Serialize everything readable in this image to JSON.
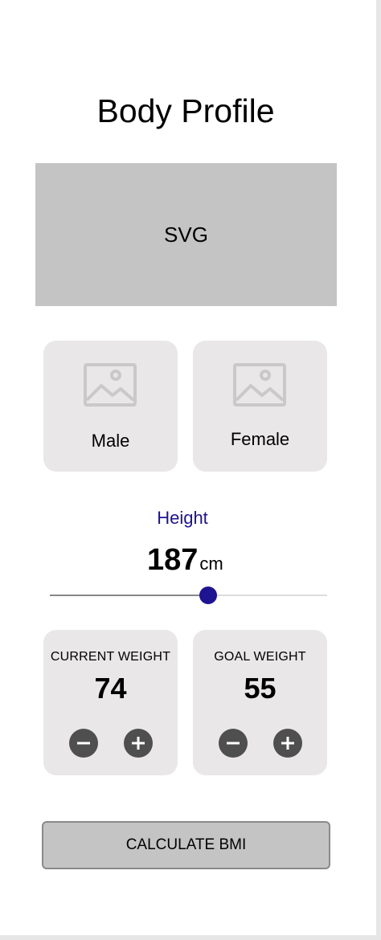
{
  "header": {
    "title": "Body Profile"
  },
  "figure": {
    "placeholder_label": "SVG"
  },
  "gender": {
    "options": [
      {
        "label": "Male",
        "icon": "image-icon"
      },
      {
        "label": "Female",
        "icon": "image-icon"
      }
    ]
  },
  "height": {
    "label": "Height",
    "value": "187",
    "unit": "cm",
    "slider_fraction": 0.57,
    "accent_color": "#1e1390"
  },
  "weights": {
    "current": {
      "title": "CURRENT WEIGHT",
      "value": "74"
    },
    "goal": {
      "title": "GOAL WEIGHT",
      "value": "55"
    }
  },
  "actions": {
    "calculate_label": "CALCULATE BMI"
  },
  "colors": {
    "card_bg": "#e9e7e8",
    "placeholder_bg": "#c4c4c4",
    "button_dark": "#4f4f4f"
  }
}
